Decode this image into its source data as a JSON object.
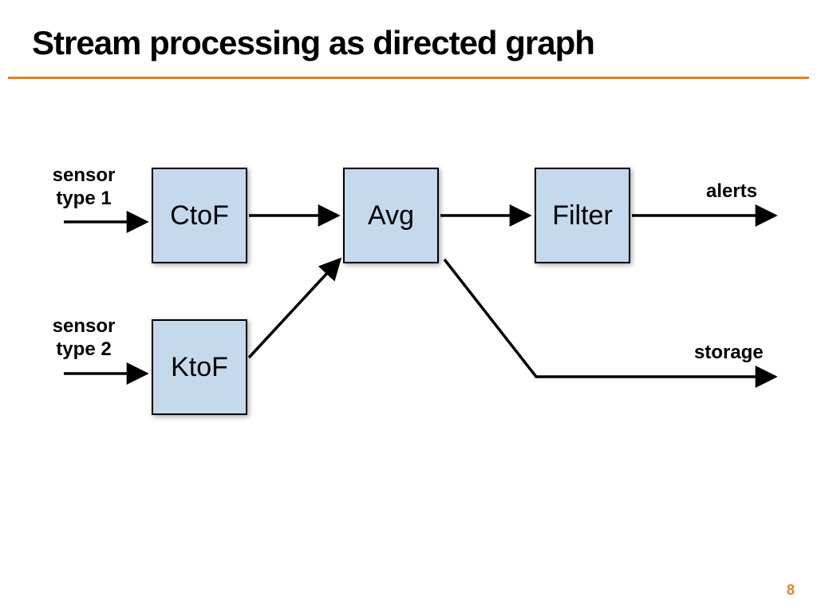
{
  "title": "Stream processing as directed graph",
  "page_number": "8",
  "inputs": {
    "sensor1": "sensor\ntype 1",
    "sensor2": "sensor\ntype 2"
  },
  "outputs": {
    "alerts": "alerts",
    "storage": "storage"
  },
  "nodes": {
    "ctof": "CtoF",
    "ktof": "KtoF",
    "avg": "Avg",
    "filter": "Filter"
  },
  "colors": {
    "accent": "#e67e22",
    "node_fill": "#c5d9ec"
  }
}
